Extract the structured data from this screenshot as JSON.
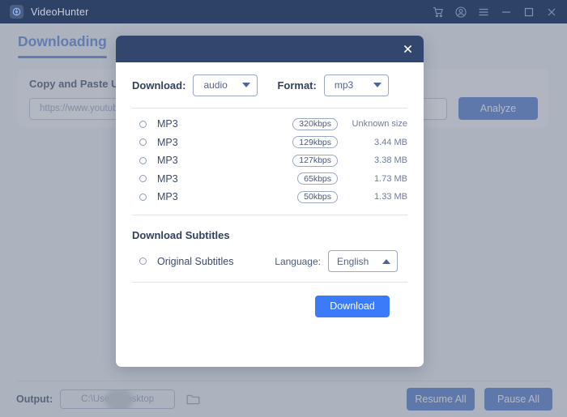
{
  "titlebar": {
    "app_name": "VideoHunter",
    "logo_icon": "videohunter-logo-icon",
    "icons": [
      {
        "name": "cart-icon",
        "glyph": "cart"
      },
      {
        "name": "account-icon",
        "glyph": "account"
      },
      {
        "name": "menu-icon",
        "glyph": "hamburger"
      },
      {
        "name": "minimize-icon",
        "glyph": "minimize"
      },
      {
        "name": "maximize-icon",
        "glyph": "maximize"
      },
      {
        "name": "close-icon",
        "glyph": "close"
      }
    ],
    "bg_color": "#2e4268"
  },
  "main": {
    "tab_label": "Downloading",
    "url_card_title": "Copy and Paste URL",
    "url_placeholder": "https://www.youtube",
    "analyze_label": "Analyze",
    "accent_color": "#3f6fcc"
  },
  "bottom": {
    "output_label": "Output:",
    "output_path": "C:\\Users\\Desktop",
    "folder_icon": "folder-icon",
    "resume_all_label": "Resume All",
    "pause_all_label": "Pause All"
  },
  "modal": {
    "close_icon": "close-icon",
    "download_label": "Download:",
    "download_value": "audio",
    "format_label": "Format:",
    "format_value": "mp3",
    "quality_rows": [
      {
        "name": "MP3",
        "bitrate": "320kbps",
        "size": "Unknown size",
        "selected": false
      },
      {
        "name": "MP3",
        "bitrate": "129kbps",
        "size": "3.44 MB",
        "selected": false
      },
      {
        "name": "MP3",
        "bitrate": "127kbps",
        "size": "3.38 MB",
        "selected": false
      },
      {
        "name": "MP3",
        "bitrate": "65kbps",
        "size": "1.73 MB",
        "selected": false
      },
      {
        "name": "MP3",
        "bitrate": "50kbps",
        "size": "1.33 MB",
        "selected": false
      }
    ],
    "subtitles_title": "Download Subtitles",
    "original_subtitles_label": "Original Subtitles",
    "language_label": "Language:",
    "language_value": "English",
    "language_caret": "up",
    "download_button_label": "Download",
    "download_button_color": "#3b7bfa"
  }
}
